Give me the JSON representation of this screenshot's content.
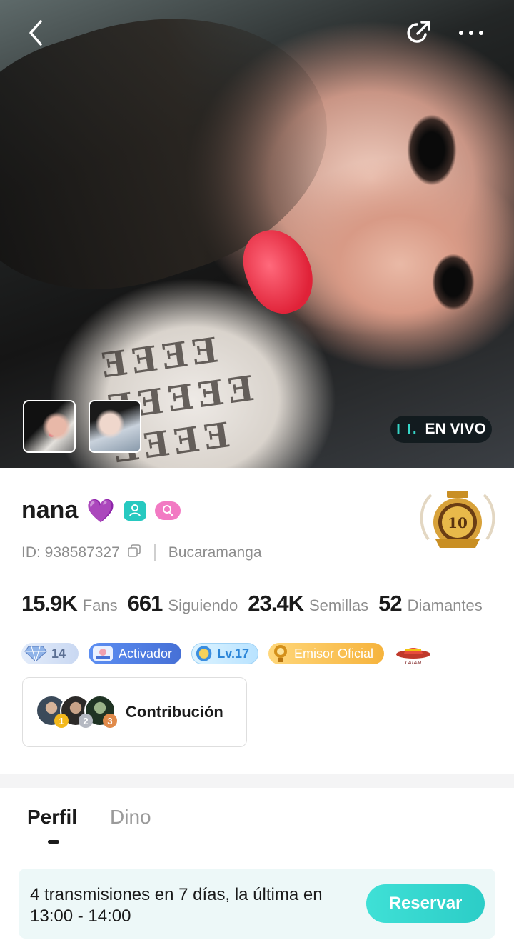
{
  "header": {
    "live_label": "EN VIVO"
  },
  "profile": {
    "name": "nana",
    "name_emoji": "💜",
    "id_text": "ID: 938587327",
    "location": "Bucaramanga"
  },
  "stats": [
    {
      "value": "15.9K",
      "label": "Fans"
    },
    {
      "value": "661",
      "label": "Siguiendo"
    },
    {
      "value": "23.4K",
      "label": "Semillas"
    },
    {
      "value": "52",
      "label": "Diamantes"
    }
  ],
  "badges": {
    "diamond_count": "14",
    "activator": "Activador",
    "level": "Lv.17",
    "emisor": "Emisor Oficial"
  },
  "contribution": {
    "label": "Contribución",
    "ranks": [
      "1",
      "2",
      "3"
    ]
  },
  "tabs": [
    {
      "label": "Perfil",
      "active": true
    },
    {
      "label": "Dino",
      "active": false
    }
  ],
  "schedule": {
    "text": "4 transmisiones en 7 días, la última en 13:00 - 14:00",
    "button": "Reservar"
  },
  "colors": {
    "accent_teal": "#2ccdc7",
    "live_bars": "#36d6c8"
  }
}
